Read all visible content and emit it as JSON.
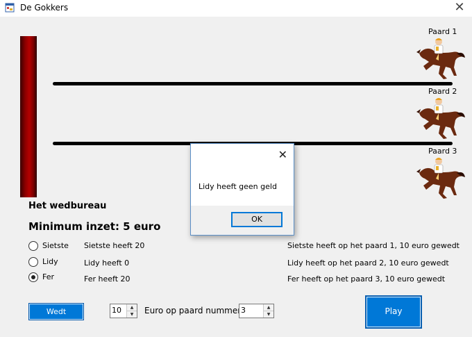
{
  "window": {
    "title": "De Gokkers"
  },
  "horses": [
    {
      "label": "Paard 1"
    },
    {
      "label": "Paard 2"
    },
    {
      "label": "Paard 3"
    }
  ],
  "betting": {
    "heading": "Het wedbureau",
    "minimum": "Minimum inzet: 5 euro",
    "players": [
      {
        "name": "Sietste",
        "balance": "Sietste heeft 20",
        "bet": "Sietste heeft op het paard 1, 10 euro gewedt",
        "selected": false
      },
      {
        "name": "Lidy",
        "balance": "Lidy heeft 0",
        "bet": "Lidy heeft op het paard 2, 10 euro gewedt",
        "selected": false
      },
      {
        "name": "Fer",
        "balance": "Fer heeft 20",
        "bet": "Fer heeft op het paard 3, 10 euro gewedt",
        "selected": true
      }
    ],
    "wedt_label": "Wedt",
    "amount": "10",
    "horse_number_label": "Euro op paard nummer:",
    "horse_number": "3",
    "play_label": "Play"
  },
  "dialog": {
    "message": "Lidy heeft geen geld",
    "ok_label": "OK"
  },
  "colors": {
    "accent": "#0078d7",
    "finish_line": "#8a0000"
  },
  "icons": {
    "app": "app-window-icon",
    "close": "close-icon",
    "horse": "racehorse-jockey-icon"
  }
}
